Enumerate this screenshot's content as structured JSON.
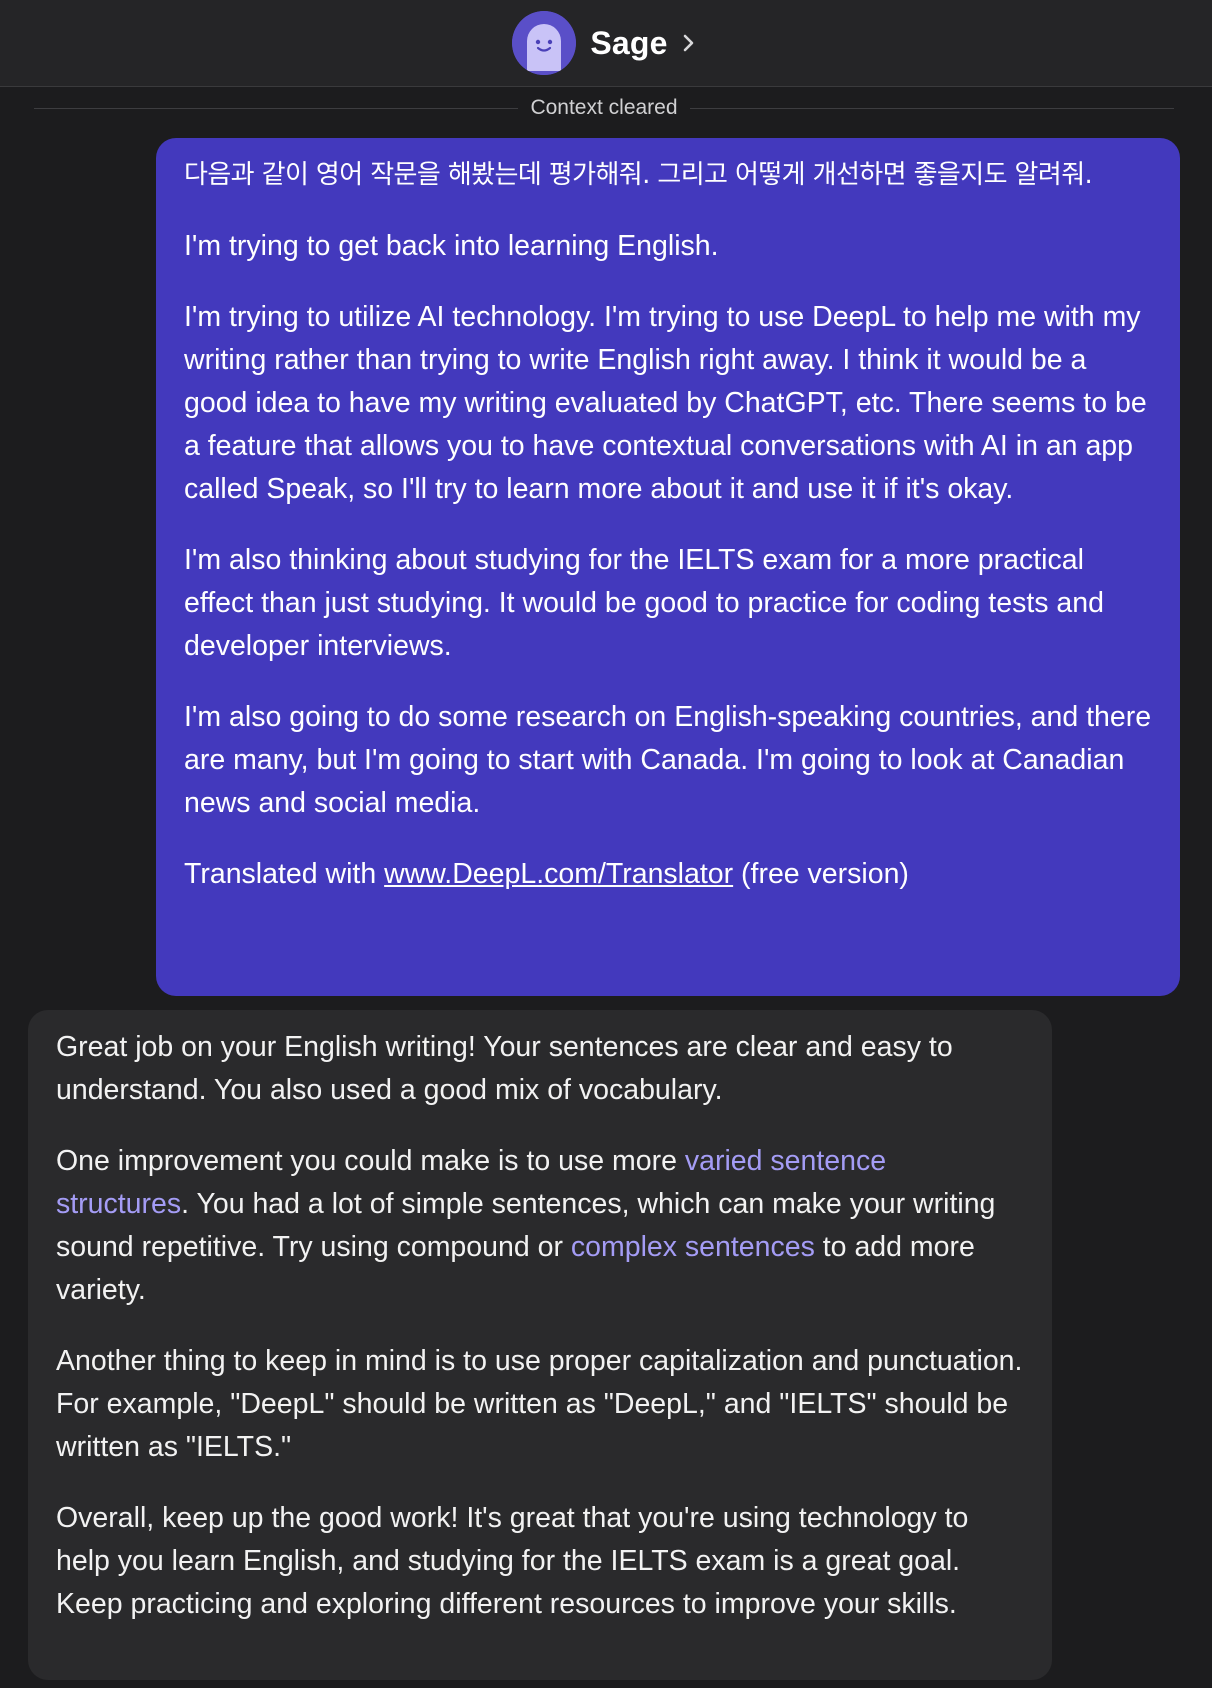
{
  "header": {
    "bot_name": "Sage",
    "avatar_icon": "smiley-ghost-icon",
    "chevron_icon": "chevron-right-icon"
  },
  "divider": {
    "label": "Context cleared"
  },
  "user_message": {
    "line1": "다음과 같이 영어 작문을 해봤는데 평가해줘. 그리고 어떻게 개선하면 좋을지도 알려줘.",
    "p1": "I'm trying to get back into learning English.",
    "p2": "I'm trying to utilize AI technology. I'm trying to use DeepL to help me with my writing rather than trying to write English right away. I think it would be a good idea to have my writing evaluated by ChatGPT, etc. There seems to be a feature that allows you to have contextual conversations with AI in an app called Speak, so I'll try to learn more about it and use it if it's okay.",
    "p3": "I'm also thinking about studying for the IELTS exam for a more practical effect than just studying. It would be good to practice for coding tests and developer interviews.",
    "p4": "I'm also going to do some research on English-speaking countries, and there are many, but I'm going to start with Canada. I'm going to look at Canadian news and social media.",
    "p5_prefix": "Translated with ",
    "p5_link": "www.DeepL.com/Translator",
    "p5_suffix": " (free version)"
  },
  "bot_message": {
    "p1": "Great job on your English writing! Your sentences are clear and easy to understand. You also used a good mix of vocabulary.",
    "p2_a": "One improvement you could make is to use more ",
    "p2_link1": "varied sentence structures",
    "p2_b": ". You had a lot of simple sentences, which can make your writing sound repetitive. Try using compound or ",
    "p2_link2": "complex sentences",
    "p2_c": " to add more variety.",
    "p3": "Another thing to keep in mind is to use proper capitalization and punctuation. For example, \"DeepL\" should be written as \"DeepL,\" and \"IELTS\" should be written as \"IELTS.\"",
    "p4": "Overall, keep up the good work! It's great that you're using technology to help you learn English, and studying for the IELTS exam is a great goal. Keep practicing and exploring different resources to improve your skills."
  },
  "colors": {
    "background": "#1c1c1e",
    "header_bg": "#252527",
    "user_bubble": "#4339bd",
    "bot_bubble": "#2a2a2c",
    "link_highlight": "#a49cf5",
    "avatar": "#5a4fc8"
  }
}
